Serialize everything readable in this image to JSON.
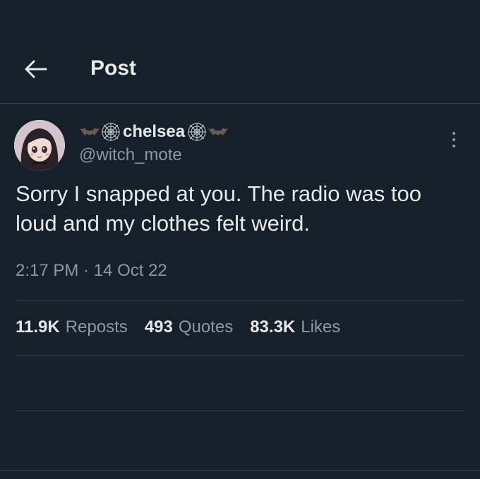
{
  "header": {
    "title": "Post",
    "back_icon": "arrow-left-icon"
  },
  "author": {
    "display_name": "chelsea",
    "handle": "@witch_mote",
    "decorations": [
      "bat-icon",
      "spiderweb-icon",
      "spiderweb-icon",
      "bat-icon"
    ]
  },
  "post": {
    "text": "Sorry I snapped at you. The radio was too loud and my clothes felt weird.",
    "timestamp": "2:17 PM · 14 Oct 22"
  },
  "stats": [
    {
      "count": "11.9K",
      "label": "Reposts"
    },
    {
      "count": "493",
      "label": "Quotes"
    },
    {
      "count": "83.3K",
      "label": "Likes"
    }
  ],
  "colors": {
    "background": "#15202b",
    "text": "#e7e9ea",
    "secondary": "#8b98a5",
    "divider": "#38444d"
  }
}
